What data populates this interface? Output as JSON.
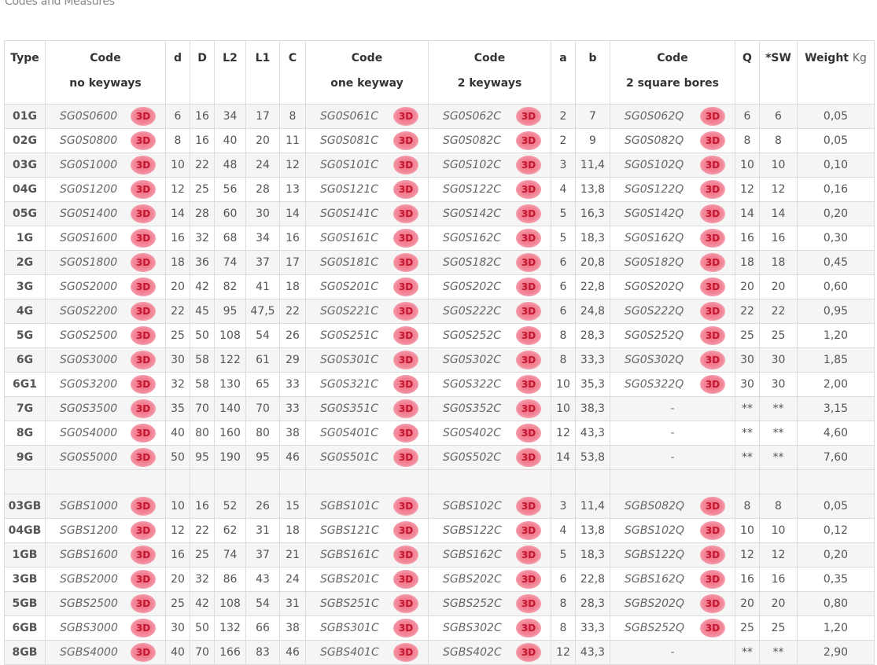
{
  "title": "Codes and Measures",
  "badge_label": "3D",
  "dash": "-",
  "headers": [
    {
      "l1": "Type",
      "l2": ""
    },
    {
      "l1": "Code",
      "l2": "no keyways"
    },
    {
      "l1": "d",
      "l2": ""
    },
    {
      "l1": "D",
      "l2": ""
    },
    {
      "l1": "L2",
      "l2": ""
    },
    {
      "l1": "L1",
      "l2": ""
    },
    {
      "l1": "C",
      "l2": ""
    },
    {
      "l1": "Code",
      "l2": "one keyway"
    },
    {
      "l1": "Code",
      "l2": "2 keyways"
    },
    {
      "l1": "a",
      "l2": ""
    },
    {
      "l1": "b",
      "l2": ""
    },
    {
      "l1": "Code",
      "l2": "2 square bores"
    },
    {
      "l1": "Q",
      "l2": ""
    },
    {
      "l1": "*SW",
      "l2": ""
    },
    {
      "l1": "Weight",
      "l2": "",
      "unit": "Kg"
    }
  ],
  "rows": [
    [
      "01G",
      "SG0S0600",
      "6",
      "16",
      "34",
      "17",
      "8",
      "SG0S061C",
      "SG0S062C",
      "2",
      "7",
      "SG0S062Q",
      "6",
      "6",
      "0,05"
    ],
    [
      "02G",
      "SG0S0800",
      "8",
      "16",
      "40",
      "20",
      "11",
      "SG0S081C",
      "SG0S082C",
      "2",
      "9",
      "SG0S082Q",
      "8",
      "8",
      "0,05"
    ],
    [
      "03G",
      "SG0S1000",
      "10",
      "22",
      "48",
      "24",
      "12",
      "SG0S101C",
      "SG0S102C",
      "3",
      "11,4",
      "SG0S102Q",
      "10",
      "10",
      "0,10"
    ],
    [
      "04G",
      "SG0S1200",
      "12",
      "25",
      "56",
      "28",
      "13",
      "SG0S121C",
      "SG0S122C",
      "4",
      "13,8",
      "SG0S122Q",
      "12",
      "12",
      "0,16"
    ],
    [
      "05G",
      "SG0S1400",
      "14",
      "28",
      "60",
      "30",
      "14",
      "SG0S141C",
      "SG0S142C",
      "5",
      "16,3",
      "SG0S142Q",
      "14",
      "14",
      "0,20"
    ],
    [
      "1G",
      "SG0S1600",
      "16",
      "32",
      "68",
      "34",
      "16",
      "SG0S161C",
      "SG0S162C",
      "5",
      "18,3",
      "SG0S162Q",
      "16",
      "16",
      "0,30"
    ],
    [
      "2G",
      "SG0S1800",
      "18",
      "36",
      "74",
      "37",
      "17",
      "SG0S181C",
      "SG0S182C",
      "6",
      "20,8",
      "SG0S182Q",
      "18",
      "18",
      "0,45"
    ],
    [
      "3G",
      "SG0S2000",
      "20",
      "42",
      "82",
      "41",
      "18",
      "SG0S201C",
      "SG0S202C",
      "6",
      "22,8",
      "SG0S202Q",
      "20",
      "20",
      "0,60"
    ],
    [
      "4G",
      "SG0S2200",
      "22",
      "45",
      "95",
      "47,5",
      "22",
      "SG0S221C",
      "SG0S222C",
      "6",
      "24,8",
      "SG0S222Q",
      "22",
      "22",
      "0,95"
    ],
    [
      "5G",
      "SG0S2500",
      "25",
      "50",
      "108",
      "54",
      "26",
      "SG0S251C",
      "SG0S252C",
      "8",
      "28,3",
      "SG0S252Q",
      "25",
      "25",
      "1,20"
    ],
    [
      "6G",
      "SG0S3000",
      "30",
      "58",
      "122",
      "61",
      "29",
      "SG0S301C",
      "SG0S302C",
      "8",
      "33,3",
      "SG0S302Q",
      "30",
      "30",
      "1,85"
    ],
    [
      "6G1",
      "SG0S3200",
      "32",
      "58",
      "130",
      "65",
      "33",
      "SG0S321C",
      "SG0S322C",
      "10",
      "35,3",
      "SG0S322Q",
      "30",
      "30",
      "2,00"
    ],
    [
      "7G",
      "SG0S3500",
      "35",
      "70",
      "140",
      "70",
      "33",
      "SG0S351C",
      "SG0S352C",
      "10",
      "38,3",
      "-",
      "**",
      "**",
      "3,15"
    ],
    [
      "8G",
      "SG0S4000",
      "40",
      "80",
      "160",
      "80",
      "38",
      "SG0S401C",
      "SG0S402C",
      "12",
      "43,3",
      "-",
      "**",
      "**",
      "4,60"
    ],
    [
      "9G",
      "SG0S5000",
      "50",
      "95",
      "190",
      "95",
      "46",
      "SG0S501C",
      "SG0S502C",
      "14",
      "53,8",
      "-",
      "**",
      "**",
      "7,60"
    ],
    null,
    [
      "03GB",
      "SGBS1000",
      "10",
      "16",
      "52",
      "26",
      "15",
      "SGBS101C",
      "SGBS102C",
      "3",
      "11,4",
      "SGBS082Q",
      "8",
      "8",
      "0,05"
    ],
    [
      "04GB",
      "SGBS1200",
      "12",
      "22",
      "62",
      "31",
      "18",
      "SGBS121C",
      "SGBS122C",
      "4",
      "13,8",
      "SGBS102Q",
      "10",
      "10",
      "0,12"
    ],
    [
      "1GB",
      "SGBS1600",
      "16",
      "25",
      "74",
      "37",
      "21",
      "SGBS161C",
      "SGBS162C",
      "5",
      "18,3",
      "SGBS122Q",
      "12",
      "12",
      "0,20"
    ],
    [
      "3GB",
      "SGBS2000",
      "20",
      "32",
      "86",
      "43",
      "24",
      "SGBS201C",
      "SGBS202C",
      "6",
      "22,8",
      "SGBS162Q",
      "16",
      "16",
      "0,35"
    ],
    [
      "5GB",
      "SGBS2500",
      "25",
      "42",
      "108",
      "54",
      "31",
      "SGBS251C",
      "SGBS252C",
      "8",
      "28,3",
      "SGBS202Q",
      "20",
      "20",
      "0,80"
    ],
    [
      "6GB",
      "SGBS3000",
      "30",
      "50",
      "132",
      "66",
      "38",
      "SGBS301C",
      "SGBS302C",
      "8",
      "33,3",
      "SGBS252Q",
      "25",
      "25",
      "1,20"
    ],
    [
      "8GB",
      "SGBS4000",
      "40",
      "70",
      "166",
      "83",
      "46",
      "SGBS401C",
      "SGBS402C",
      "12",
      "43,3",
      "-",
      "**",
      "**",
      "2,90"
    ]
  ]
}
